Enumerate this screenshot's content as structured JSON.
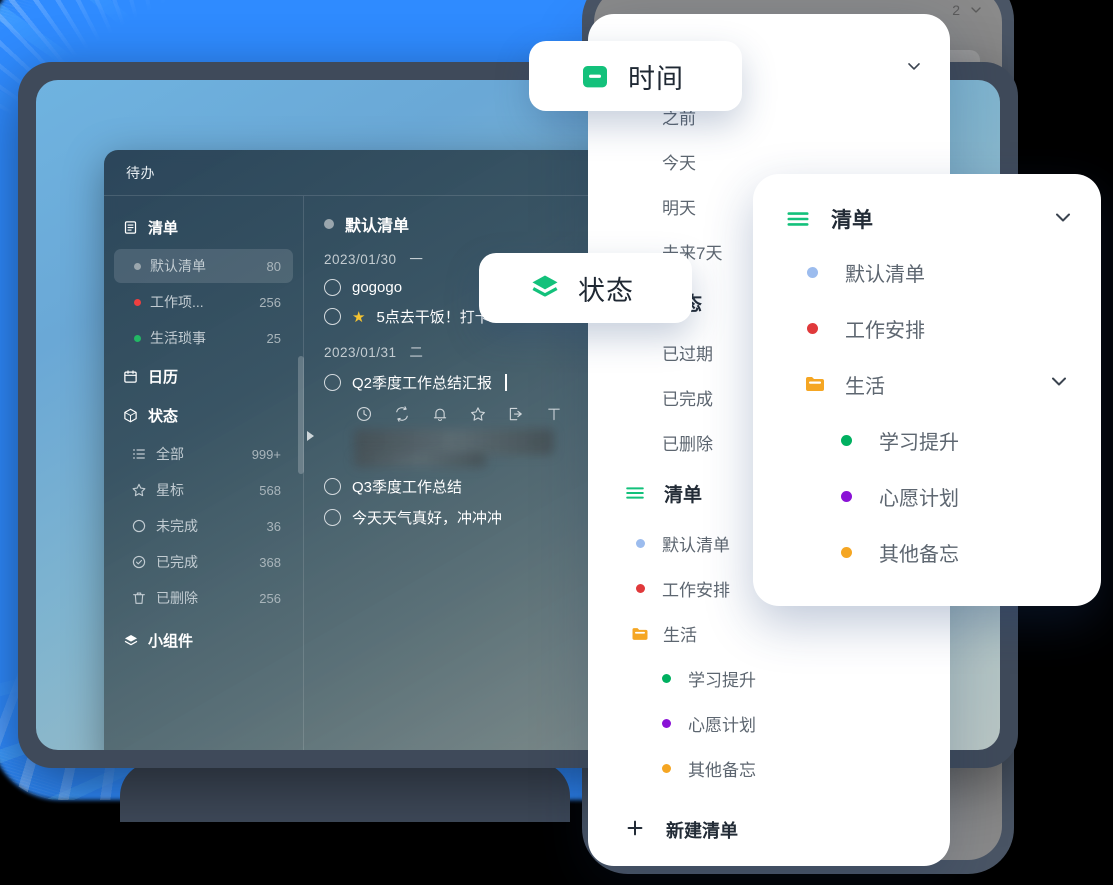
{
  "desktop_app": {
    "window_title": "待办",
    "sidebar": {
      "lists_group": {
        "label": "清单",
        "icon": "list-icon"
      },
      "lists": [
        {
          "label": "默认清单",
          "count": "80",
          "color": "#9aa6ad",
          "selected": true
        },
        {
          "label": "工作项...",
          "count": "256",
          "color": "#ef3f3f",
          "selected": false
        },
        {
          "label": "生活琐事",
          "count": "25",
          "color": "#22b864",
          "selected": false
        }
      ],
      "calendar_group": {
        "label": "日历",
        "icon": "calendar-icon"
      },
      "status_group": {
        "label": "状态",
        "icon": "cube-icon"
      },
      "statuses": [
        {
          "label": "全部",
          "count": "999+",
          "icon": "list-all-icon"
        },
        {
          "label": "星标",
          "count": "568",
          "icon": "star-icon"
        },
        {
          "label": "未完成",
          "count": "36",
          "icon": "circle-icon"
        },
        {
          "label": "已完成",
          "count": "368",
          "icon": "check-circle-icon"
        },
        {
          "label": "已删除",
          "count": "256",
          "icon": "trash-icon"
        }
      ],
      "widgets_group": {
        "label": "小组件",
        "icon": "layers-icon"
      }
    },
    "task_panel": {
      "header": "默认清单",
      "groups": [
        {
          "date": "2023/01/30",
          "weekday": "一",
          "tasks": [
            {
              "text": "gogogo",
              "starred": false,
              "editing": false
            },
            {
              "text": "5点去干饭！打卡",
              "starred": true,
              "editing": false
            }
          ]
        },
        {
          "date": "2023/01/31",
          "weekday": "二",
          "tasks": [
            {
              "text": "Q2季度工作总结汇报",
              "starred": false,
              "editing": true
            },
            {
              "text": "Q3季度工作总结",
              "starred": false,
              "editing": false
            },
            {
              "text": "今天天气真好，冲冲冲",
              "starred": false,
              "editing": false
            }
          ]
        }
      ],
      "editor_icons": [
        "clock-icon",
        "repeat-icon",
        "bell-icon",
        "star-icon",
        "move-to-icon",
        "text-format-icon"
      ]
    }
  },
  "mobile_device": {
    "top_counter": "2",
    "top_chevron": "chevron-down-icon",
    "fab_label": "+"
  },
  "menu_panel": {
    "time_section": {
      "title": "时间",
      "icon": "calendar-green-icon",
      "chevron": "chevron-down-icon",
      "items": [
        "之前",
        "今天",
        "明天",
        "未来7天"
      ]
    },
    "status_section": {
      "title": "状态",
      "icon": "stack-green-icon",
      "items": [
        "已过期",
        "已完成",
        "已删除"
      ]
    },
    "list_section": {
      "title": "清单",
      "icon": "menu-lines-green-icon",
      "items": [
        {
          "label": "默认清单",
          "color": "#9cbcee",
          "sub": false
        },
        {
          "label": "工作安排",
          "color": "#e0393b",
          "sub": false
        },
        {
          "label": "生活",
          "color": "#f5a623",
          "sub": false,
          "folder": true
        },
        {
          "label": "学习提升",
          "color": "#00b060",
          "sub": true
        },
        {
          "label": "心愿计划",
          "color": "#8a12d6",
          "sub": true
        },
        {
          "label": "其他备忘",
          "color": "#f5a623",
          "sub": true
        }
      ],
      "new_list": {
        "label": "新建清单",
        "icon": "plus-icon"
      }
    }
  },
  "floating_card": {
    "title": "清单",
    "icon": "menu-lines-green-icon",
    "chevron": "chevron-down-icon",
    "items": [
      {
        "label": "默认清单",
        "color": "#9cbcee",
        "sub": false,
        "folder": false,
        "chevron": false
      },
      {
        "label": "工作安排",
        "color": "#e0393b",
        "sub": false,
        "folder": false,
        "chevron": false
      },
      {
        "label": "生活",
        "color": "#f5a623",
        "sub": false,
        "folder": true,
        "chevron": true
      },
      {
        "label": "学习提升",
        "color": "#00b060",
        "sub": true,
        "folder": false,
        "chevron": false
      },
      {
        "label": "心愿计划",
        "color": "#8a12d6",
        "sub": true,
        "folder": false,
        "chevron": false
      },
      {
        "label": "其他备忘",
        "color": "#f5a623",
        "sub": true,
        "folder": false,
        "chevron": false
      }
    ]
  },
  "colors": {
    "accent_green": "#13c17b",
    "glow_blue": "#2f8bff",
    "device_bezel": "#3f4a5a",
    "fab_green": "#15794f"
  }
}
